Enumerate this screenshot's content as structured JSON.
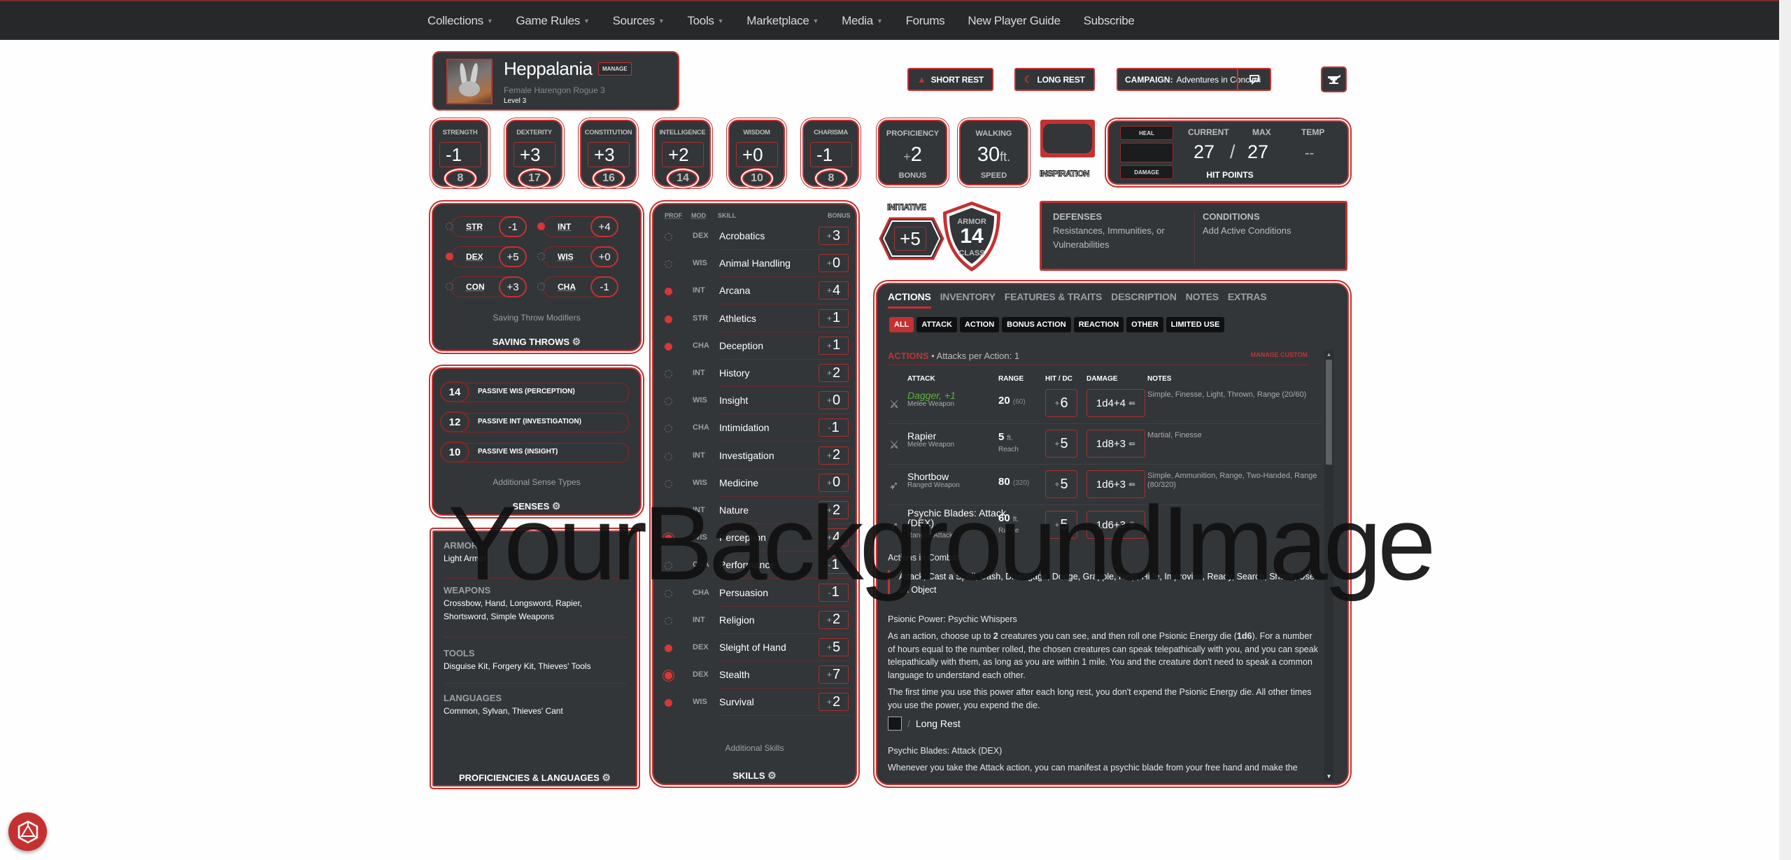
{
  "nav": {
    "items": [
      {
        "label": "Collections",
        "dropdown": true
      },
      {
        "label": "Game Rules",
        "dropdown": true
      },
      {
        "label": "Sources",
        "dropdown": true
      },
      {
        "label": "Tools",
        "dropdown": true
      },
      {
        "label": "Marketplace",
        "dropdown": true
      },
      {
        "label": "Media",
        "dropdown": true
      },
      {
        "label": "Forums",
        "dropdown": false
      },
      {
        "label": "New Player Guide",
        "dropdown": false
      },
      {
        "label": "Subscribe",
        "dropdown": false
      }
    ],
    "caret": "▼"
  },
  "watermark": "YourBackgroundImage",
  "character": {
    "name": "Heppalania",
    "manage_label": "MANAGE",
    "summary": "Female  Harengon  Rogue 3",
    "level": "Level 3"
  },
  "header_buttons": {
    "short_rest": "SHORT REST",
    "long_rest": "LONG REST",
    "campaign_label": "CAMPAIGN:",
    "campaign_name": "Adventures in Concieri",
    "short_rest_icon": "campfire-icon",
    "long_rest_icon": "moon-icon",
    "chat_icon": "chat-icon",
    "forge_icon": "anvil-icon"
  },
  "abilities": [
    {
      "name": "STRENGTH",
      "modifier": "-1",
      "score": "8"
    },
    {
      "name": "DEXTERITY",
      "modifier": "+3",
      "score": "17"
    },
    {
      "name": "CONSTITUTION",
      "modifier": "+3",
      "score": "16"
    },
    {
      "name": "INTELLIGENCE",
      "modifier": "+2",
      "score": "14"
    },
    {
      "name": "WISDOM",
      "modifier": "+0",
      "score": "10"
    },
    {
      "name": "CHARISMA",
      "modifier": "-1",
      "score": "8"
    }
  ],
  "proficiency": {
    "title": "PROFICIENCY",
    "sign": "+",
    "value": "2",
    "label": "BONUS"
  },
  "speed": {
    "title": "WALKING",
    "value": "30",
    "unit": "ft.",
    "label": "SPEED"
  },
  "inspiration": {
    "label": "INSPIRATION",
    "active": false
  },
  "hit_points": {
    "heal_label": "HEAL",
    "damage_label": "DAMAGE",
    "current_label": "CURRENT",
    "max_label": "MAX",
    "temp_label": "TEMP",
    "current": "27",
    "separator": "/",
    "max": "27",
    "temp": "--",
    "title": "HIT POINTS"
  },
  "saving_throws": {
    "items": [
      {
        "ability": "STR",
        "modifier": "-1",
        "proficient": false
      },
      {
        "ability": "INT",
        "modifier": "+4",
        "proficient": true
      },
      {
        "ability": "DEX",
        "modifier": "+5",
        "proficient": true
      },
      {
        "ability": "WIS",
        "modifier": "+0",
        "proficient": false
      },
      {
        "ability": "CON",
        "modifier": "+3",
        "proficient": false
      },
      {
        "ability": "CHA",
        "modifier": "-1",
        "proficient": false
      }
    ],
    "note": "Saving Throw Modifiers",
    "title": "SAVING THROWS"
  },
  "senses": {
    "items": [
      {
        "value": "14",
        "label": "PASSIVE WIS (PERCEPTION)"
      },
      {
        "value": "12",
        "label": "PASSIVE INT (INVESTIGATION)"
      },
      {
        "value": "10",
        "label": "PASSIVE WIS (INSIGHT)"
      }
    ],
    "note": "Additional Sense Types",
    "title": "SENSES"
  },
  "proficiencies": {
    "sections": [
      {
        "heading": "ARMOR",
        "value": "Light Armor"
      },
      {
        "heading": "WEAPONS",
        "value": "Crossbow, Hand, Longsword, Rapier, Shortsword, Simple Weapons"
      },
      {
        "heading": "TOOLS",
        "value": "Disguise Kit, Forgery Kit, Thieves' Tools"
      },
      {
        "heading": "LANGUAGES",
        "value": "Common, Sylvan, Thieves' Cant"
      }
    ],
    "title": "PROFICIENCIES & LANGUAGES"
  },
  "skills": {
    "headers": {
      "prof": "PROF",
      "mod": "MOD",
      "skill": "SKILL",
      "bonus": "BONUS"
    },
    "items": [
      {
        "prof": "none",
        "mod": "DEX",
        "name": "Acrobatics",
        "sign": "+",
        "value": "3"
      },
      {
        "prof": "none",
        "mod": "WIS",
        "name": "Animal Handling",
        "sign": "+",
        "value": "0"
      },
      {
        "prof": "proficient",
        "mod": "INT",
        "name": "Arcana",
        "sign": "+",
        "value": "4"
      },
      {
        "prof": "proficient",
        "mod": "STR",
        "name": "Athletics",
        "sign": "+",
        "value": "1"
      },
      {
        "prof": "proficient",
        "mod": "CHA",
        "name": "Deception",
        "sign": "+",
        "value": "1"
      },
      {
        "prof": "none",
        "mod": "INT",
        "name": "History",
        "sign": "+",
        "value": "2"
      },
      {
        "prof": "none",
        "mod": "WIS",
        "name": "Insight",
        "sign": "+",
        "value": "0"
      },
      {
        "prof": "none",
        "mod": "CHA",
        "name": "Intimidation",
        "sign": "-",
        "value": "1"
      },
      {
        "prof": "none",
        "mod": "INT",
        "name": "Investigation",
        "sign": "+",
        "value": "2"
      },
      {
        "prof": "none",
        "mod": "WIS",
        "name": "Medicine",
        "sign": "+",
        "value": "0"
      },
      {
        "prof": "none",
        "mod": "INT",
        "name": "Nature",
        "sign": "+",
        "value": "2"
      },
      {
        "prof": "expertise",
        "mod": "WIS",
        "name": "Perception",
        "sign": "+",
        "value": "4"
      },
      {
        "prof": "none",
        "mod": "CHA",
        "name": "Performance",
        "sign": "-",
        "value": "1"
      },
      {
        "prof": "none",
        "mod": "CHA",
        "name": "Persuasion",
        "sign": "-",
        "value": "1"
      },
      {
        "prof": "none",
        "mod": "INT",
        "name": "Religion",
        "sign": "+",
        "value": "2"
      },
      {
        "prof": "proficient",
        "mod": "DEX",
        "name": "Sleight of Hand",
        "sign": "+",
        "value": "5"
      },
      {
        "prof": "expertise",
        "mod": "DEX",
        "name": "Stealth",
        "sign": "+",
        "value": "7"
      },
      {
        "prof": "proficient",
        "mod": "WIS",
        "name": "Survival",
        "sign": "+",
        "value": "2"
      }
    ],
    "note": "Additional Skills",
    "title": "SKILLS"
  },
  "initiative": {
    "label": "INITIATIVE",
    "value": "+5"
  },
  "armor_class": {
    "top": "ARMOR",
    "value": "14",
    "bottom": "CLASS"
  },
  "defenses": {
    "heading": "DEFENSES",
    "value": "Resistances, Immunities, or Vulnerabilities"
  },
  "conditions": {
    "heading": "CONDITIONS",
    "value": "Add Active Conditions"
  },
  "actions_panel": {
    "tabs": [
      {
        "label": "ACTIONS",
        "active": true
      },
      {
        "label": "INVENTORY",
        "active": false
      },
      {
        "label": "FEATURES & TRAITS",
        "active": false
      },
      {
        "label": "DESCRIPTION",
        "active": false
      },
      {
        "label": "NOTES",
        "active": false
      },
      {
        "label": "EXTRAS",
        "active": false
      }
    ],
    "filters": [
      {
        "label": "ALL",
        "active": true
      },
      {
        "label": "ATTACK",
        "active": false
      },
      {
        "label": "ACTION",
        "active": false
      },
      {
        "label": "BONUS ACTION",
        "active": false
      },
      {
        "label": "REACTION",
        "active": false
      },
      {
        "label": "OTHER",
        "active": false
      },
      {
        "label": "LIMITED USE",
        "active": false
      }
    ],
    "section_title": "ACTIONS",
    "section_sub": " • Attacks per Action: 1",
    "manage_custom": "MANAGE CUSTOM",
    "attack_headers": {
      "attack": "ATTACK",
      "range": "RANGE",
      "hit": "HIT / DC",
      "damage": "DAMAGE",
      "notes": "NOTES"
    },
    "attacks": [
      {
        "icon": "melee-weapon-icon",
        "name": "Dagger, +1",
        "magic": true,
        "type": "Melee Weapon",
        "range": "20",
        "range_long": "(60)",
        "range_unit": "",
        "range_sub": "",
        "hit_sign": "+",
        "hit": "6",
        "damage": "1d4+4",
        "damage_type_icon": "piercing-icon",
        "notes": "Simple, Finesse, Light, Thrown, Range (20/60)"
      },
      {
        "icon": "melee-weapon-icon",
        "name": "Rapier",
        "magic": false,
        "type": "Melee Weapon",
        "range": "5",
        "range_long": "",
        "range_unit": "ft.",
        "range_sub": "Reach",
        "hit_sign": "+",
        "hit": "5",
        "damage": "1d8+3",
        "damage_type_icon": "piercing-icon",
        "notes": "Martial, Finesse"
      },
      {
        "icon": "ranged-weapon-icon",
        "name": "Shortbow",
        "magic": false,
        "type": "Ranged Weapon",
        "range": "80",
        "range_long": "(320)",
        "range_unit": "",
        "range_sub": "",
        "hit_sign": "+",
        "hit": "5",
        "damage": "1d6+3",
        "damage_type_icon": "piercing-icon",
        "notes": "Simple, Ammunition, Range, Two-Handed, Range (80/320)"
      },
      {
        "icon": "ranged-attack-icon",
        "name": "Psychic Blades: Attack (DEX)",
        "magic": false,
        "type": "Ranged Attack",
        "range": "60",
        "range_long": "",
        "range_unit": "ft.",
        "range_sub": "Range",
        "hit_sign": "+",
        "hit": "5",
        "damage": "1d6+3",
        "damage_type_icon": "psychic-icon",
        "notes": ""
      }
    ],
    "combat_heading": "Actions in Combat",
    "combat_list": "Attack, Cast a Spell, Dash, Disengage, Dodge, Grapple, Help, Hide, Improvise, Ready, Search, Shove, Use an Object",
    "feature1": {
      "heading": "Psionic Power: Psychic Whispers",
      "p1_a": "As an action, choose up to ",
      "p1_b": "2",
      "p1_c": " creatures you can see, and then roll one Psionic Energy die (",
      "p1_d": "1d6",
      "p1_e": "). For a number of hours equal to the number rolled, the chosen creatures can speak telepathically with you, and you can speak telepathically with them, as long as you are within 1 mile. You and the creature don't need to speak a common language to understand each other.",
      "p2": "The first time you use this power after each long rest, you don't expend the Psionic Energy die. All other times you use the power, you expend the die.",
      "slot_sep": "/",
      "slot_label": "Long Rest",
      "slot_used": false
    },
    "feature2": {
      "heading": "Psychic Blades: Attack (DEX)",
      "p1": "Whenever you take the Attack action, you can manifest a psychic blade from your free hand and make the"
    }
  },
  "colors": {
    "accent": "#c53131",
    "panel": "#323639",
    "nav": "#26282a",
    "magic": "#5bb53b"
  },
  "dice_button_icon": "d20-icon"
}
